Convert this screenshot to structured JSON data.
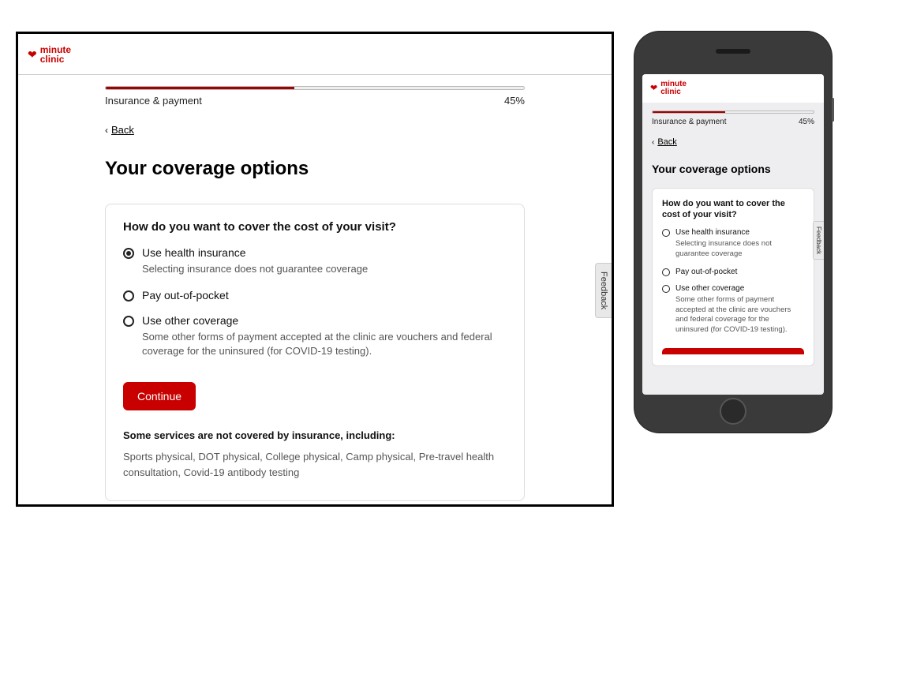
{
  "brand": {
    "line1": "minute",
    "line2": "clinic"
  },
  "progress": {
    "section_label": "Insurance & payment",
    "percent_label": "45%",
    "percent_value": 45
  },
  "nav": {
    "back_label": "Back"
  },
  "page": {
    "title": "Your coverage options"
  },
  "card": {
    "question": "How do you want to cover the cost of your visit?",
    "options": [
      {
        "label": "Use health insurance",
        "sub": "Selecting insurance does not guarantee coverage",
        "selected_desktop": true,
        "selected_mobile": false
      },
      {
        "label": "Pay out-of-pocket",
        "sub": "",
        "selected_desktop": false,
        "selected_mobile": false
      },
      {
        "label": "Use other coverage",
        "sub": "Some other forms of payment accepted at the clinic are vouchers and federal coverage for the uninsured (for COVID-19 testing).",
        "selected_desktop": false,
        "selected_mobile": false
      }
    ],
    "continue_label": "Continue"
  },
  "disclaimer": {
    "heading": "Some services are not covered by insurance, including:",
    "body": "Sports physical, DOT physical, College physical, Camp physical, Pre-travel health consultation, Covid-19 antibody testing"
  },
  "feedback": {
    "label": "Feedback"
  }
}
